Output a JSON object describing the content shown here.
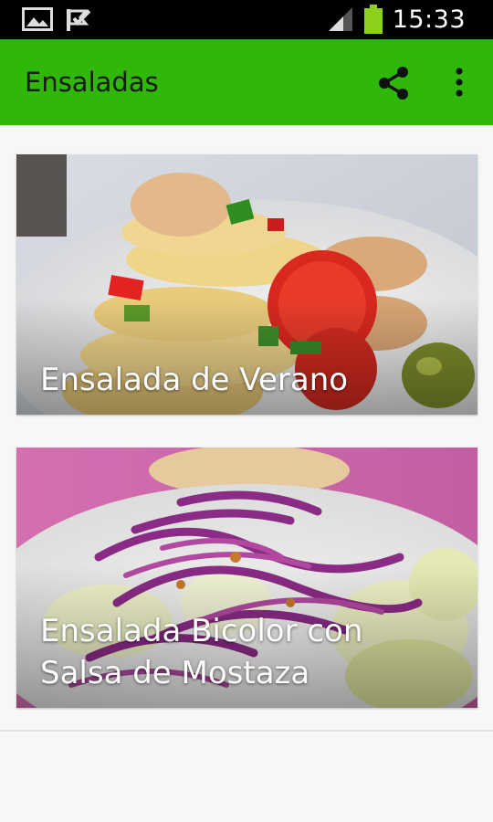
{
  "status_bar": {
    "time": "15:33",
    "icons": [
      "image-icon",
      "check-flag-icon",
      "signal-icon",
      "battery-icon"
    ]
  },
  "app_bar": {
    "title": "Ensaladas",
    "actions": [
      "share-icon",
      "overflow-menu-icon"
    ],
    "color": "#2fb80a"
  },
  "recipes": [
    {
      "title": "Ensalada de Verano"
    },
    {
      "title": "Ensalada Bicolor con\nSalsa de Mostaza"
    }
  ]
}
